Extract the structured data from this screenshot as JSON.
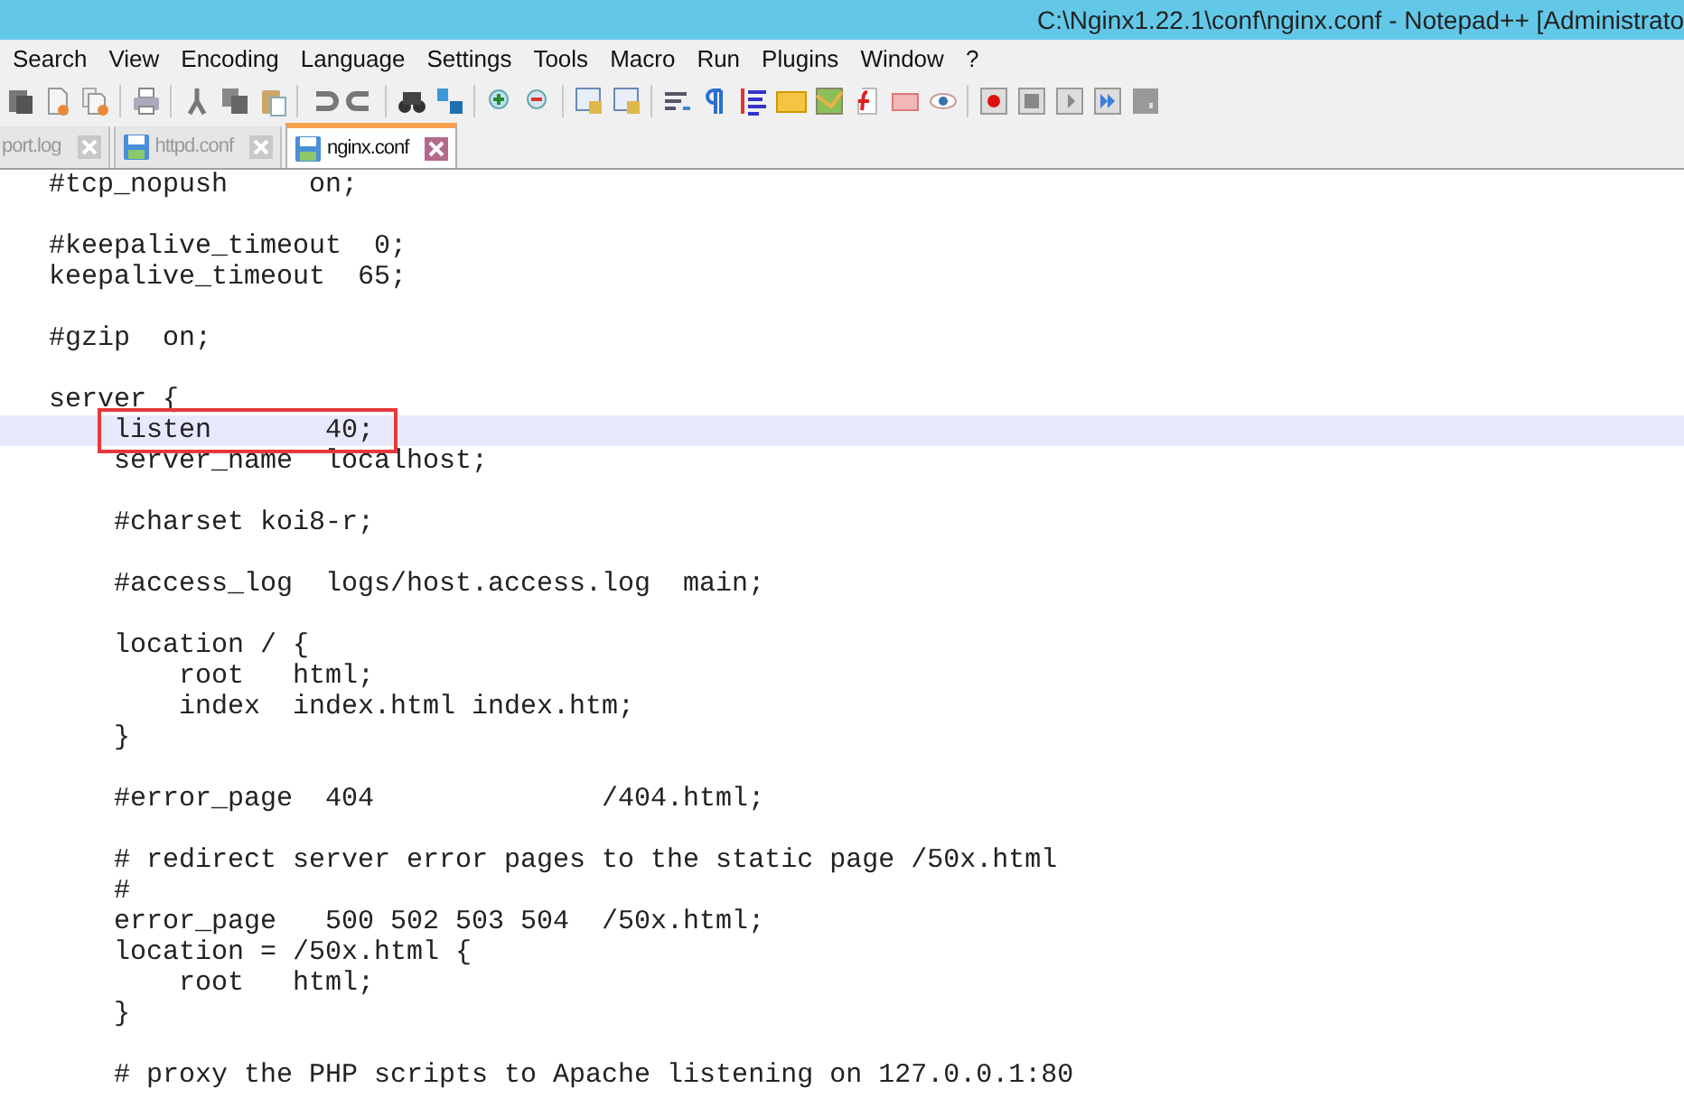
{
  "window": {
    "title": "C:\\Nginx1.22.1\\conf\\nginx.conf - Notepad++ [Administrato"
  },
  "menu": [
    "Search",
    "View",
    "Encoding",
    "Language",
    "Settings",
    "Tools",
    "Macro",
    "Run",
    "Plugins",
    "Window",
    "?"
  ],
  "tabs": [
    {
      "label": "port.log",
      "selected": false
    },
    {
      "label": "httpd.conf",
      "selected": false
    },
    {
      "label": "nginx.conf",
      "selected": true
    }
  ],
  "editor": {
    "blocks": [
      {
        "lines": [
          {
            "text": "#tcp_nopush     on;",
            "current": false,
            "boxed": false
          }
        ]
      },
      {
        "lines": [
          {
            "text": "#keepalive_timeout  0;",
            "current": false,
            "boxed": false
          },
          {
            "text": "keepalive_timeout  65;",
            "current": false,
            "boxed": false
          }
        ]
      },
      {
        "lines": [
          {
            "text": "#gzip  on;",
            "current": false,
            "boxed": false
          }
        ]
      },
      {
        "lines": [
          {
            "text": "server {",
            "current": false,
            "boxed": false
          },
          {
            "text": "    listen       40;",
            "current": true,
            "boxed": true
          },
          {
            "text": "    server_name  localhost;",
            "current": false,
            "boxed": false
          }
        ]
      },
      {
        "lines": [
          {
            "text": "    #charset koi8-r;",
            "current": false,
            "boxed": false
          }
        ]
      },
      {
        "lines": [
          {
            "text": "    #access_log  logs/host.access.log  main;",
            "current": false,
            "boxed": false
          }
        ]
      },
      {
        "lines": [
          {
            "text": "    location / {",
            "current": false,
            "boxed": false
          },
          {
            "text": "        root   html;",
            "current": false,
            "boxed": false
          },
          {
            "text": "        index  index.html index.htm;",
            "current": false,
            "boxed": false
          },
          {
            "text": "    }",
            "current": false,
            "boxed": false
          }
        ]
      },
      {
        "lines": [
          {
            "text": "    #error_page  404              /404.html;",
            "current": false,
            "boxed": false
          }
        ]
      },
      {
        "lines": [
          {
            "text": "    # redirect server error pages to the static page /50x.html",
            "current": false,
            "boxed": false
          },
          {
            "text": "    #",
            "current": false,
            "boxed": false
          },
          {
            "text": "    error_page   500 502 503 504  /50x.html;",
            "current": false,
            "boxed": false
          },
          {
            "text": "    location = /50x.html {",
            "current": false,
            "boxed": false
          },
          {
            "text": "        root   html;",
            "current": false,
            "boxed": false
          },
          {
            "text": "    }",
            "current": false,
            "boxed": false
          }
        ]
      },
      {
        "lines": [
          {
            "text": "    # proxy the PHP scripts to Apache listening on 127.0.0.1:80",
            "current": false,
            "boxed": false
          }
        ]
      }
    ]
  }
}
